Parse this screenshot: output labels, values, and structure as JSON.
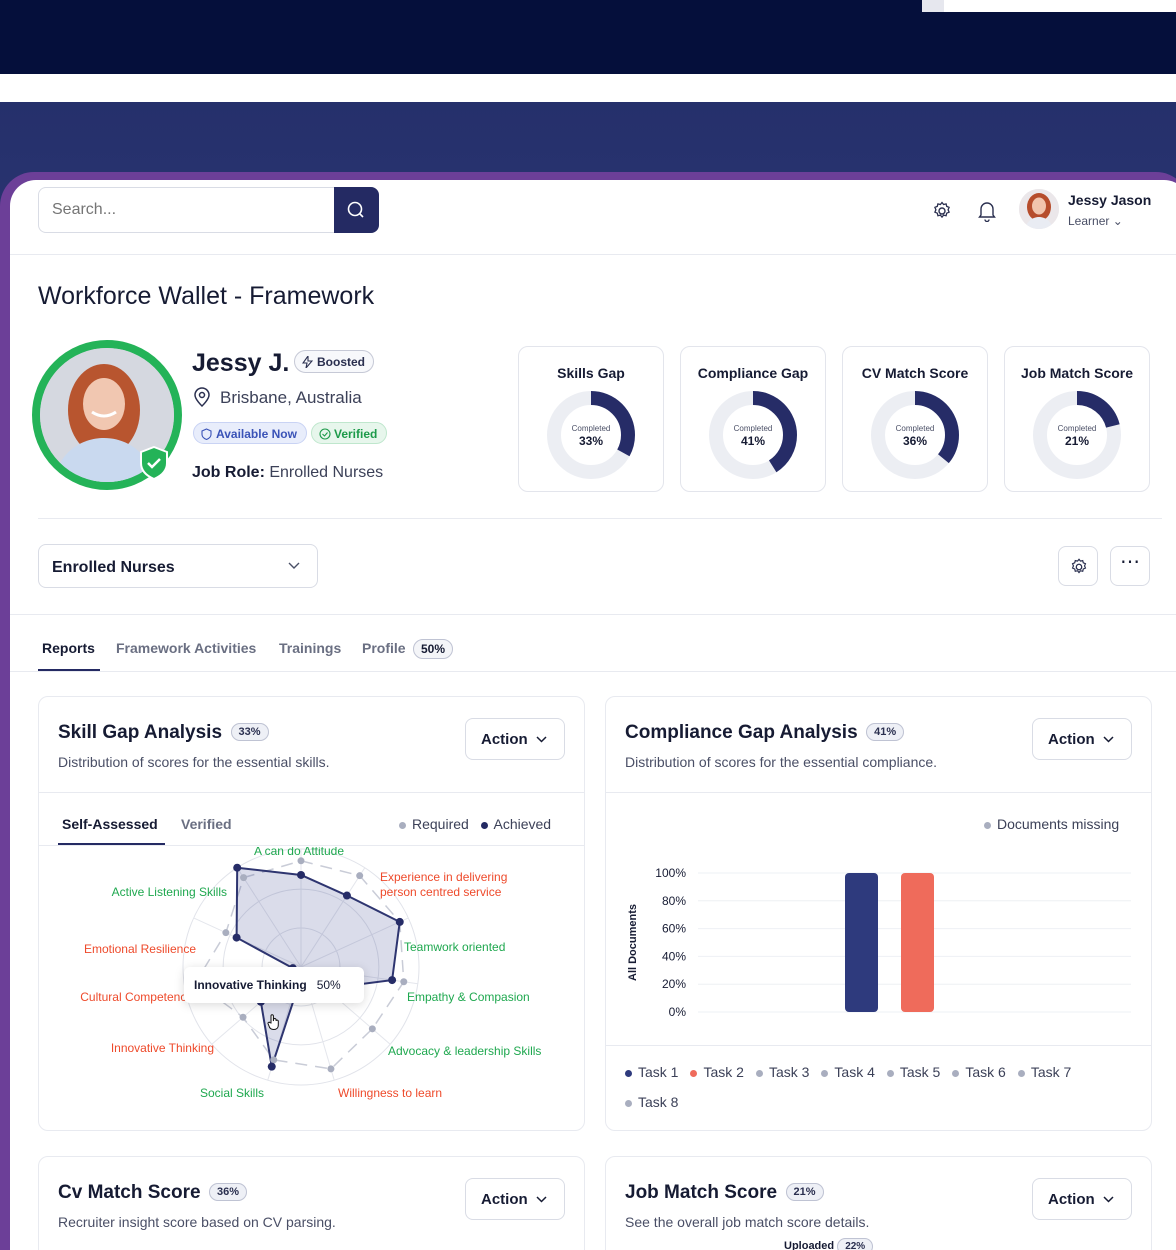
{
  "header": {
    "search_placeholder": "Search...",
    "user_name": "Jessy Jason",
    "user_role": "Learner"
  },
  "page": {
    "title": "Workforce Wallet - Framework"
  },
  "profile": {
    "name": "Jessy J.",
    "boosted": "Boosted",
    "location": "Brisbane, Australia",
    "available": "Available Now",
    "verified": "Verified",
    "job_role_label": "Job Role:",
    "job_role_value": "Enrolled Nurses"
  },
  "stats": [
    {
      "title": "Skills Gap",
      "label": "Completed",
      "value": "33%",
      "pct": 33
    },
    {
      "title": "Compliance Gap",
      "label": "Completed",
      "value": "41%",
      "pct": 41
    },
    {
      "title": "CV Match Score",
      "label": "Completed",
      "value": "36%",
      "pct": 36
    },
    {
      "title": "Job Match Score",
      "label": "Completed",
      "value": "21%",
      "pct": 21
    }
  ],
  "framework_select": "Enrolled Nurses",
  "tabs": {
    "reports": "Reports",
    "activities": "Framework Activities",
    "trainings": "Trainings",
    "profile": "Profile",
    "profile_badge": "50%"
  },
  "skill_gap": {
    "title": "Skill Gap Analysis",
    "badge": "33%",
    "subtitle": "Distribution of scores for the essential skills.",
    "action": "Action",
    "tab_self": "Self-Assessed",
    "tab_verified": "Verified",
    "legend_required": "Required",
    "legend_achieved": "Achieved",
    "tooltip_label": "Innovative Thinking",
    "tooltip_value": "50%"
  },
  "compliance_gap": {
    "title": "Compliance Gap Analysis",
    "badge": "41%",
    "subtitle": "Distribution of scores for the essential compliance.",
    "action": "Action",
    "legend_missing": "Documents missing"
  },
  "cv_match": {
    "title": "Cv Match Score",
    "badge": "36%",
    "subtitle": "Recruiter insight score based on CV parsing.",
    "action": "Action"
  },
  "job_match": {
    "title": "Job Match Score",
    "badge": "21%",
    "subtitle": "See the overall job match score details.",
    "action": "Action",
    "uploaded_label": "Uploaded",
    "uploaded_value": "22%"
  },
  "chart_data": [
    {
      "type": "radar",
      "title": "Skill Gap Analysis",
      "categories": [
        "A can do Attitude",
        "Experience in delivering person centred service",
        "Teamwork oriented",
        "Empathy & Compasion",
        "Advocacy & leadership Skills",
        "Willingness to learn",
        "Social Skills",
        "Innovative Thinking",
        "Cultural Competence",
        "Emotional Resilience",
        "Active Listening Skills"
      ],
      "category_colors": [
        "#1fa84f",
        "#ee4a2b",
        "#1fa84f",
        "#1fa84f",
        "#1fa84f",
        "#ee4a2b",
        "#1fa84f",
        "#ee4a2b",
        "#ee4a2b",
        "#ee4a2b",
        "#1fa84f"
      ],
      "series": [
        {
          "name": "Required",
          "values": [
            0.9,
            0.92,
            0.92,
            0.88,
            0.8,
            0.9,
            0.82,
            0.65,
            0.9,
            0.7,
            0.9
          ]
        },
        {
          "name": "Achieved",
          "values": [
            0.78,
            0.72,
            0.92,
            0.78,
            0.28,
            0.05,
            0.88,
            0.45,
            0.07,
            0.6,
            1.0
          ]
        }
      ]
    },
    {
      "type": "bar",
      "title": "Compliance Gap Analysis",
      "ylabel": "All Documents",
      "yticks": [
        "0%",
        "20%",
        "40%",
        "60%",
        "80%",
        "100%"
      ],
      "ylim": [
        0,
        100
      ],
      "categories": [
        "Task 1",
        "Task 2",
        "Task 3",
        "Task 4",
        "Task 5",
        "Task 6",
        "Task 7",
        "Task 8"
      ],
      "values": [
        100,
        100,
        0,
        0,
        0,
        0,
        0,
        0
      ],
      "colors": [
        "#2e3a7d",
        "#ef6b5b",
        "#a9aebf",
        "#a9aebf",
        "#a9aebf",
        "#a9aebf",
        "#a9aebf",
        "#a9aebf"
      ]
    }
  ]
}
